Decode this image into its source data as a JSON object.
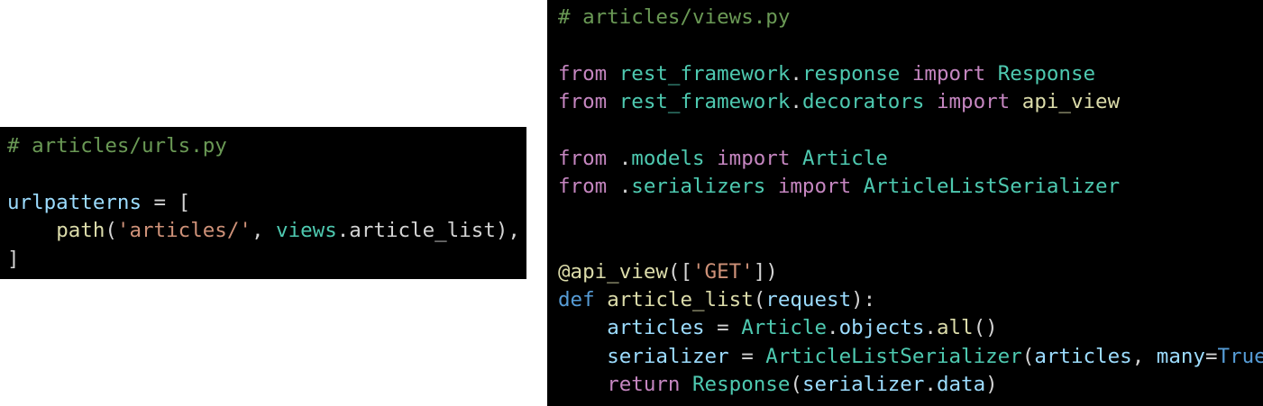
{
  "colors": {
    "background": "#000000",
    "comment": "#6a9955",
    "keyword": "#c586c0",
    "def_keyword": "#569cd6",
    "module": "#4ec9b0",
    "function": "#dcdcaa",
    "variable": "#9cdcfe",
    "string": "#ce9178",
    "plain": "#d4d4d4"
  },
  "urls_code": {
    "lines": [
      [
        {
          "t": "# articles/urls.py",
          "c": "comment"
        }
      ],
      [],
      [
        {
          "t": "urlpatterns",
          "c": "var"
        },
        {
          "t": " = [",
          "c": "plain"
        }
      ],
      [
        {
          "t": "    ",
          "c": "plain"
        },
        {
          "t": "path",
          "c": "func"
        },
        {
          "t": "(",
          "c": "plain"
        },
        {
          "t": "'articles/'",
          "c": "string"
        },
        {
          "t": ", ",
          "c": "plain"
        },
        {
          "t": "views",
          "c": "module"
        },
        {
          "t": ".article_list),",
          "c": "plain"
        }
      ],
      [
        {
          "t": "]",
          "c": "plain"
        }
      ]
    ]
  },
  "views_code": {
    "lines": [
      [
        {
          "t": "# articles/views.py",
          "c": "comment"
        }
      ],
      [],
      [
        {
          "t": "from",
          "c": "keyword"
        },
        {
          "t": " ",
          "c": "plain"
        },
        {
          "t": "rest_framework",
          "c": "module"
        },
        {
          "t": ".",
          "c": "plain"
        },
        {
          "t": "response",
          "c": "module"
        },
        {
          "t": " ",
          "c": "plain"
        },
        {
          "t": "import",
          "c": "keyword"
        },
        {
          "t": " ",
          "c": "plain"
        },
        {
          "t": "Response",
          "c": "class"
        }
      ],
      [
        {
          "t": "from",
          "c": "keyword"
        },
        {
          "t": " ",
          "c": "plain"
        },
        {
          "t": "rest_framework",
          "c": "module"
        },
        {
          "t": ".",
          "c": "plain"
        },
        {
          "t": "decorators",
          "c": "module"
        },
        {
          "t": " ",
          "c": "plain"
        },
        {
          "t": "import",
          "c": "keyword"
        },
        {
          "t": " ",
          "c": "plain"
        },
        {
          "t": "api_view",
          "c": "func"
        }
      ],
      [],
      [
        {
          "t": "from",
          "c": "keyword"
        },
        {
          "t": " .",
          "c": "plain"
        },
        {
          "t": "models",
          "c": "module"
        },
        {
          "t": " ",
          "c": "plain"
        },
        {
          "t": "import",
          "c": "keyword"
        },
        {
          "t": " ",
          "c": "plain"
        },
        {
          "t": "Article",
          "c": "class"
        }
      ],
      [
        {
          "t": "from",
          "c": "keyword"
        },
        {
          "t": " .",
          "c": "plain"
        },
        {
          "t": "serializers",
          "c": "module"
        },
        {
          "t": " ",
          "c": "plain"
        },
        {
          "t": "import",
          "c": "keyword"
        },
        {
          "t": " ",
          "c": "plain"
        },
        {
          "t": "ArticleListSerializer",
          "c": "class"
        }
      ],
      [],
      [],
      [
        {
          "t": "@api_view",
          "c": "func"
        },
        {
          "t": "([",
          "c": "plain"
        },
        {
          "t": "'GET'",
          "c": "string"
        },
        {
          "t": "])",
          "c": "plain"
        }
      ],
      [
        {
          "t": "def",
          "c": "def"
        },
        {
          "t": " ",
          "c": "plain"
        },
        {
          "t": "article_list",
          "c": "func"
        },
        {
          "t": "(",
          "c": "plain"
        },
        {
          "t": "request",
          "c": "var"
        },
        {
          "t": "):",
          "c": "plain"
        }
      ],
      [
        {
          "t": "    ",
          "c": "plain"
        },
        {
          "t": "articles",
          "c": "var"
        },
        {
          "t": " = ",
          "c": "plain"
        },
        {
          "t": "Article",
          "c": "class"
        },
        {
          "t": ".",
          "c": "plain"
        },
        {
          "t": "objects",
          "c": "var"
        },
        {
          "t": ".",
          "c": "plain"
        },
        {
          "t": "all",
          "c": "func"
        },
        {
          "t": "()",
          "c": "plain"
        }
      ],
      [
        {
          "t": "    ",
          "c": "plain"
        },
        {
          "t": "serializer",
          "c": "var"
        },
        {
          "t": " = ",
          "c": "plain"
        },
        {
          "t": "ArticleListSerializer",
          "c": "class"
        },
        {
          "t": "(",
          "c": "plain"
        },
        {
          "t": "articles",
          "c": "var"
        },
        {
          "t": ", ",
          "c": "plain"
        },
        {
          "t": "many",
          "c": "var"
        },
        {
          "t": "=",
          "c": "plain"
        },
        {
          "t": "True",
          "c": "const"
        },
        {
          "t": ")",
          "c": "plain"
        }
      ],
      [
        {
          "t": "    ",
          "c": "plain"
        },
        {
          "t": "return",
          "c": "keyword"
        },
        {
          "t": " ",
          "c": "plain"
        },
        {
          "t": "Response",
          "c": "class"
        },
        {
          "t": "(",
          "c": "plain"
        },
        {
          "t": "serializer",
          "c": "var"
        },
        {
          "t": ".",
          "c": "plain"
        },
        {
          "t": "data",
          "c": "var"
        },
        {
          "t": ")",
          "c": "plain"
        }
      ]
    ]
  }
}
